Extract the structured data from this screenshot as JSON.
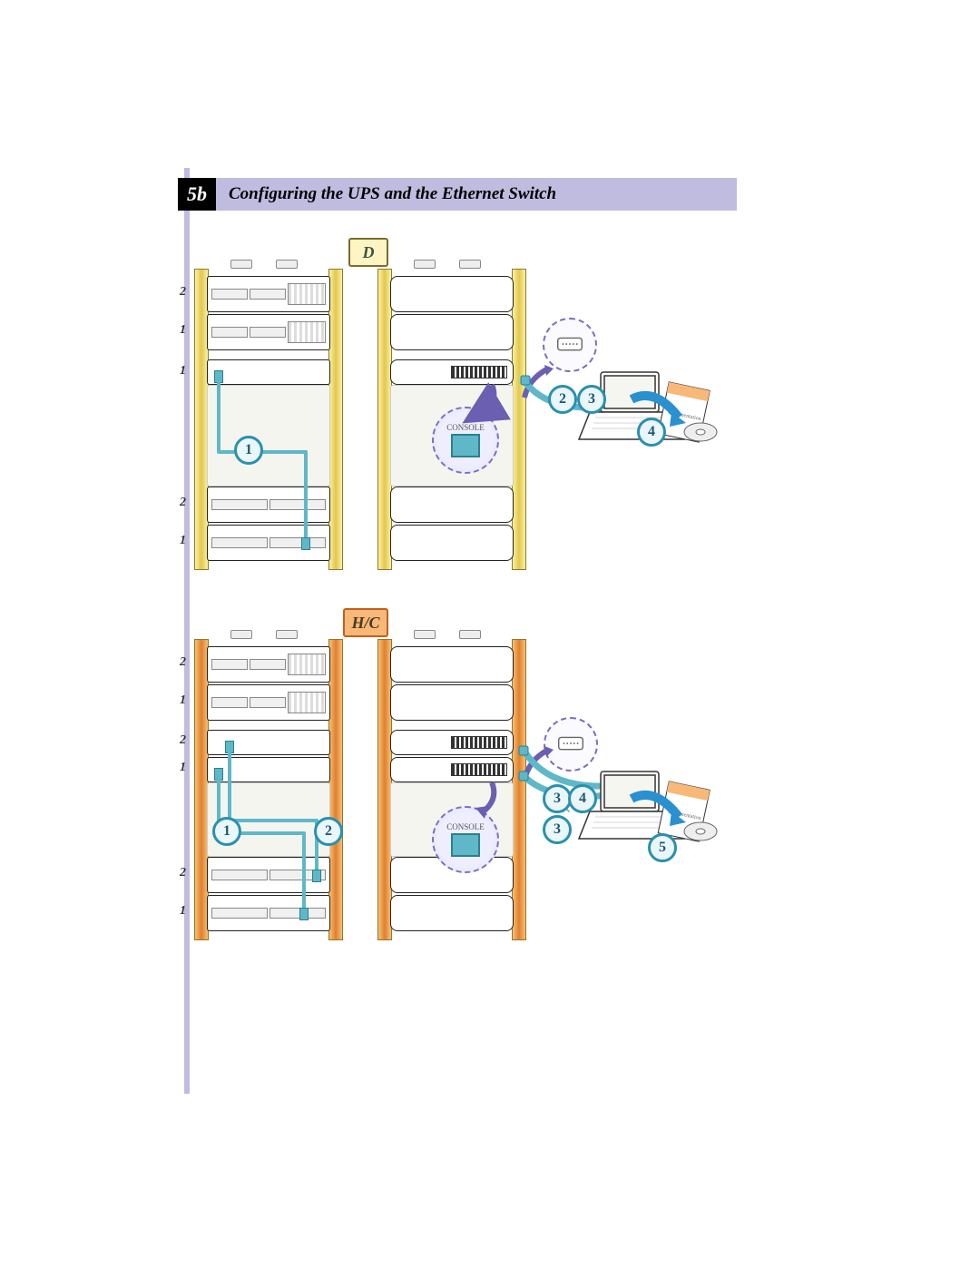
{
  "step": {
    "number": "5b",
    "title": "Configuring the UPS and the Ethernet Switch"
  },
  "variants": {
    "d": "D",
    "hc": "H/C"
  },
  "labels": {
    "console": "CONSOLE",
    "doc": "Documentation"
  },
  "rack_d": {
    "left_labels": [
      "2",
      "1",
      "1",
      "2",
      "1"
    ],
    "callouts": [
      "1"
    ],
    "right_callouts": [
      "2",
      "3",
      "4"
    ]
  },
  "rack_hc": {
    "left_labels": [
      "2",
      "1",
      "2",
      "1",
      "2",
      "1"
    ],
    "callouts": [
      "1",
      "2"
    ],
    "right_callouts": [
      "3",
      "4",
      "3",
      "5"
    ]
  },
  "colors": {
    "header_bg": "#c0bce0",
    "cable": "#5fb8c8",
    "rack_d": "#e0c850",
    "rack_hc": "#e08030",
    "callout_border": "#2a90b0"
  }
}
